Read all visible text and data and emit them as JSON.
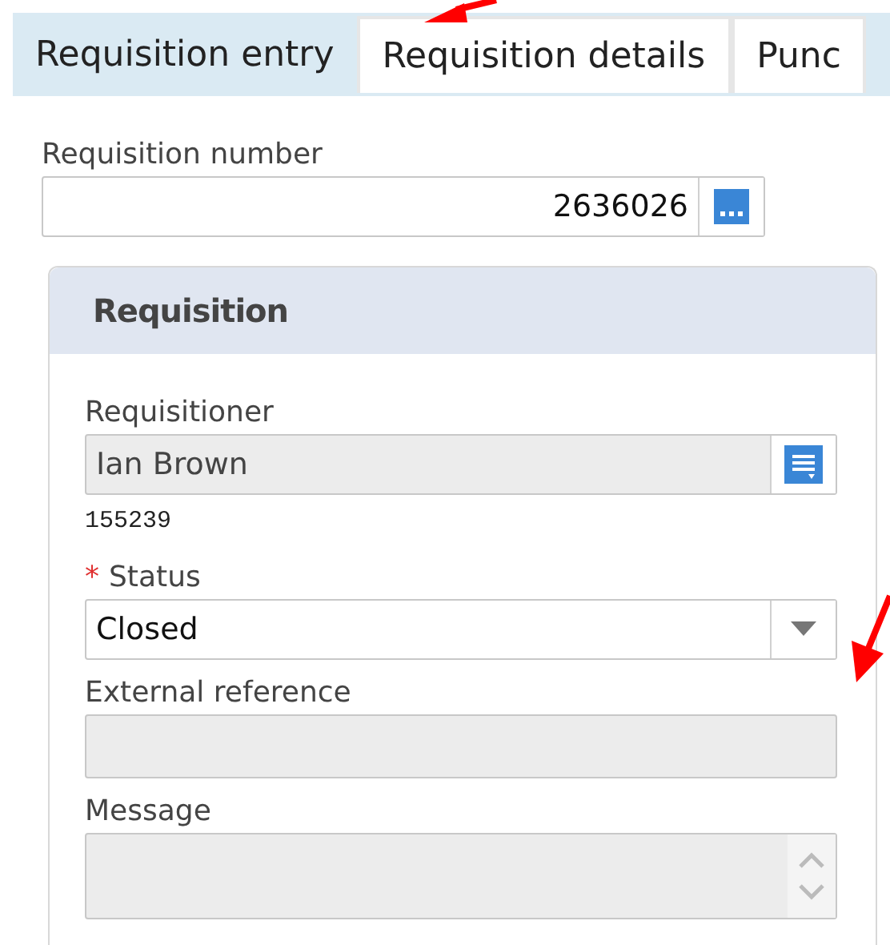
{
  "tabs": [
    {
      "label": "Requisition entry",
      "selected": true
    },
    {
      "label": "Requisition details",
      "selected": false
    },
    {
      "label": "Punc",
      "selected": false
    }
  ],
  "requisition_number": {
    "label": "Requisition number",
    "value": "2636026"
  },
  "panel": {
    "title": "Requisition",
    "fields": [
      {
        "kind": "lookup",
        "label": "Requisitioner",
        "value": "Ian Brown",
        "disabled": true,
        "note": "155239"
      },
      {
        "kind": "dropdown",
        "label": "Status",
        "value": "Closed",
        "disabled": false,
        "required_mark": "*"
      },
      {
        "kind": "text",
        "label": "External reference",
        "disabled": true
      },
      {
        "kind": "textarea",
        "label": "Message",
        "disabled": true
      }
    ]
  }
}
